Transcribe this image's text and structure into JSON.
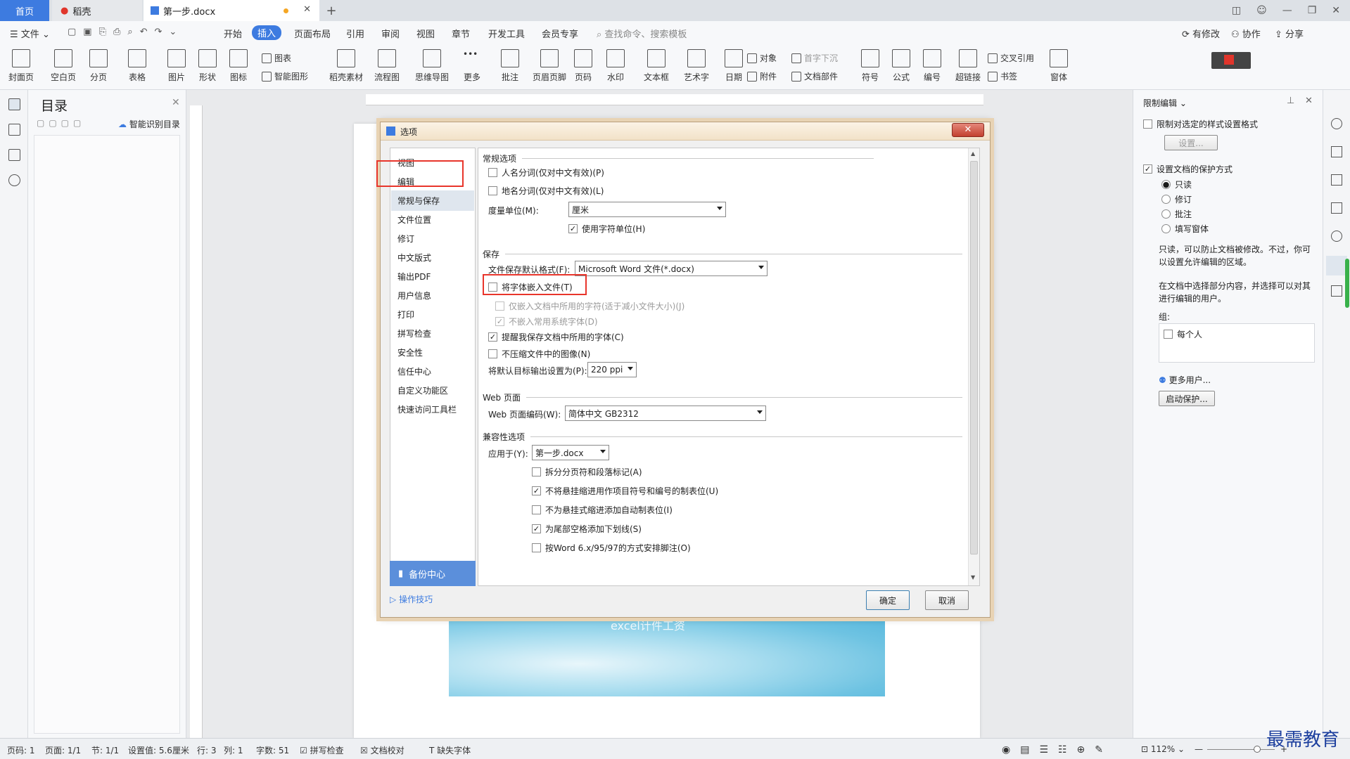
{
  "tabs": {
    "home": "首页",
    "doc1": "稻壳",
    "doc2": "第一步.docx"
  },
  "menu": {
    "file": "文件",
    "items": [
      "开始",
      "插入",
      "页面布局",
      "引用",
      "审阅",
      "视图",
      "章节",
      "开发工具",
      "会员专享"
    ],
    "active": "插入",
    "search_placeholder": "查找命令、搜索模板",
    "right": [
      "有修改",
      "协作",
      "分享"
    ]
  },
  "ribbon": {
    "big": [
      "封面页",
      "空白页",
      "分页",
      "表格",
      "图片",
      "形状",
      "图标",
      "稻壳素材",
      "流程图",
      "思维导图",
      "更多",
      "批注",
      "页眉页脚",
      "页码",
      "水印",
      "文本框",
      "艺术字",
      "日期",
      "符号",
      "公式",
      "编号",
      "超链接",
      "窗体"
    ],
    "small": [
      "图表",
      "智能图形",
      "对象",
      "附件",
      "首字下沉",
      "文档部件",
      "交叉引用",
      "书签"
    ]
  },
  "outline": {
    "title": "目录",
    "smart": "智能识别目录"
  },
  "dialog": {
    "title": "选项",
    "nav": [
      "视图",
      "编辑",
      "常规与保存",
      "文件位置",
      "修订",
      "中文版式",
      "输出PDF",
      "用户信息",
      "打印",
      "拼写检查",
      "安全性",
      "信任中心",
      "自定义功能区",
      "快速访问工具栏"
    ],
    "backup": "备份中心",
    "tips": "操作技巧",
    "sections": {
      "general": "常规选项",
      "save": "保存",
      "web": "Web 页面",
      "compat": "兼容性选项"
    },
    "general": {
      "name_seg": "人名分词(仅对中文有效)(P)",
      "place_seg": "地名分词(仅对中文有效)(L)",
      "unit_label": "度量单位(M):",
      "unit_value": "厘米",
      "char_unit": "使用字符单位(H)"
    },
    "save": {
      "format_label": "文件保存默认格式(F):",
      "format_value": "Microsoft Word 文件(*.docx)",
      "embed": "将字体嵌入文件(T)",
      "embed_used": "仅嵌入文档中所用的字符(适于减小文件大小)(J)",
      "no_common": "不嵌入常用系统字体(D)",
      "remind": "提醒我保存文档中所用的字体(C)",
      "no_compress": "不压缩文件中的图像(N)",
      "ppi_label": "将默认目标输出设置为(P):",
      "ppi_value": "220 ppi"
    },
    "web": {
      "enc_label": "Web 页面编码(W):",
      "enc_value": "简体中文 GB2312"
    },
    "compat": {
      "apply_label": "应用于(Y):",
      "apply_value": "第一步.docx",
      "opt1": "拆分分页符和段落标记(A)",
      "opt2": "不将悬挂缩进用作项目符号和编号的制表位(U)",
      "opt3": "不为悬挂式缩进添加自动制表位(I)",
      "opt4": "为尾部空格添加下划线(S)",
      "opt5": "按Word 6.x/95/97的方式安排脚注(O)"
    },
    "ok": "确定",
    "cancel": "取消"
  },
  "right_panel": {
    "title": "限制编辑",
    "restrict_fmt": "限制对选定的样式设置格式",
    "settings_btn": "设置...",
    "protect": "设置文档的保护方式",
    "modes": [
      "只读",
      "修订",
      "批注",
      "填写窗体"
    ],
    "desc1": "只读，可以防止文档被修改。不过，你可以设置允许编辑的区域。",
    "desc2": "在文档中选择部分内容，并选择可以对其进行编辑的用户。",
    "group_label": "组:",
    "everyone": "每个人",
    "more_users": "更多用户...",
    "start_btn": "启动保护..."
  },
  "status": {
    "page": "页码: 1",
    "pages": "页面: 1/1",
    "section": "节: 1/1",
    "setting": "设置值: 5.6厘米",
    "row": "行: 3",
    "col": "列: 1",
    "words": "字数: 51",
    "spell": "拼写检查",
    "proof": "文档校对",
    "missing_font": "缺失字体",
    "zoom": "112%"
  },
  "doc_text": "excel计件工资",
  "watermark": "最需教育"
}
